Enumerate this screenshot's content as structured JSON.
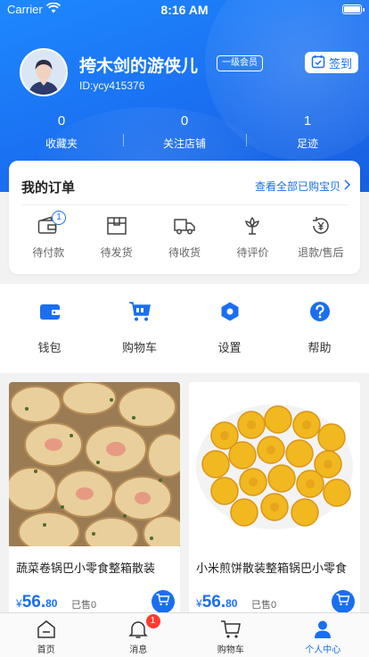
{
  "status_bar": {
    "carrier": "Carrier",
    "time": "8:16 AM"
  },
  "profile": {
    "username": "挎木剑的游侠儿",
    "member_level": "一级会员",
    "user_id": "ID:ycy415376",
    "signin_label": "签到"
  },
  "stats": [
    {
      "value": "0",
      "label": "收藏夹"
    },
    {
      "value": "0",
      "label": "关注店铺"
    },
    {
      "value": "1",
      "label": "足迹"
    }
  ],
  "orders": {
    "title": "我的订单",
    "view_all": "查看全部已购宝贝",
    "items": [
      {
        "label": "待付款",
        "icon": "wallet-card-icon",
        "badge": "1"
      },
      {
        "label": "待发货",
        "icon": "package-box-icon"
      },
      {
        "label": "待收货",
        "icon": "delivery-truck-icon"
      },
      {
        "label": "待评价",
        "icon": "flower-review-icon"
      },
      {
        "label": "退款/售后",
        "icon": "refund-yen-icon"
      }
    ]
  },
  "tools": [
    {
      "label": "钱包",
      "icon": "wallet-icon"
    },
    {
      "label": "购物车",
      "icon": "shopping-cart-icon"
    },
    {
      "label": "设置",
      "icon": "settings-hexagon-icon"
    },
    {
      "label": "帮助",
      "icon": "help-question-icon"
    }
  ],
  "products": [
    {
      "name": "蔬菜卷锅巴小零食整箱散装",
      "currency": "¥",
      "price_int": "56.",
      "price_dec": "80",
      "sold": "已售0"
    },
    {
      "name": "小米煎饼散装整箱锅巴小零食",
      "currency": "¥",
      "price_int": "56.",
      "price_dec": "80",
      "sold": "已售0"
    }
  ],
  "tabbar": [
    {
      "label": "首页",
      "icon": "home-icon"
    },
    {
      "label": "消息",
      "icon": "bell-icon",
      "badge": "1"
    },
    {
      "label": "购物车",
      "icon": "cart-icon"
    },
    {
      "label": "个人中心",
      "icon": "person-icon",
      "active": true
    }
  ],
  "colors": {
    "accent": "#1a6ff0",
    "badge_red": "#ff3b30"
  }
}
